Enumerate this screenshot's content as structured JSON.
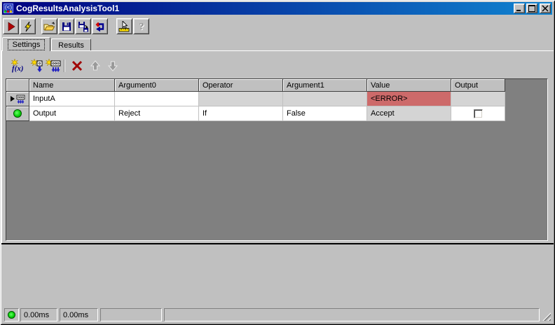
{
  "window": {
    "title": "CogResultsAnalysisTool1",
    "controls": [
      {
        "name": "minimize-button",
        "icon": "minimize-icon"
      },
      {
        "name": "maximize-button",
        "icon": "maximize-icon"
      },
      {
        "name": "close-button",
        "icon": "close-icon"
      }
    ]
  },
  "main_toolbar": {
    "icons": [
      "run-icon",
      "lightning-icon",
      "open-file-icon",
      "save-icon",
      "save-as-icon",
      "reset-icon",
      "pointer-ruler-icon",
      "help-icon"
    ]
  },
  "tabs": [
    {
      "label": "Settings",
      "active": true
    },
    {
      "label": "Results",
      "active": false
    }
  ],
  "grid_toolbar": {
    "function_label": "f(x)",
    "icons": [
      "add-function-icon",
      "add-input-icon",
      "add-inputs-icon",
      "delete-icon",
      "move-up-icon",
      "move-down-icon"
    ],
    "disabled": [
      "move-up-icon",
      "move-down-icon"
    ]
  },
  "grid": {
    "columns": [
      "Name",
      "Argument0",
      "Operator",
      "Argument1",
      "Value",
      "Output"
    ],
    "rows": [
      {
        "marker": "inputs-icon",
        "is_current": true,
        "name": "InputA",
        "argument0": "",
        "operator": "",
        "argument1": "",
        "value": "<ERROR>",
        "value_is_error": true,
        "output": "",
        "disabled_cells": [
          "operator",
          "argument1",
          "output"
        ]
      },
      {
        "marker": "green-status-icon",
        "is_current": false,
        "name": "Output",
        "argument0": "Reject",
        "operator": "If",
        "argument1": "False",
        "value": "Accept",
        "value_is_error": false,
        "output_checked": false,
        "disabled_cells": [
          "value"
        ]
      }
    ]
  },
  "status_bar": {
    "panels": [
      {
        "type": "status-indicator",
        "text": ""
      },
      {
        "text": "0.00ms"
      },
      {
        "text": "0.00ms"
      },
      {
        "text": ""
      },
      {
        "text": ""
      }
    ]
  },
  "colors": {
    "titlebar_gradient_start": "#000080",
    "titlebar_gradient_end": "#1084d0",
    "window_chrome": "#c0c0c0",
    "grid_background": "#808080",
    "error_cell_bg": "#cd6a6a",
    "disabled_cell_bg": "#d4d4d4",
    "status_green": "#00cc00"
  }
}
